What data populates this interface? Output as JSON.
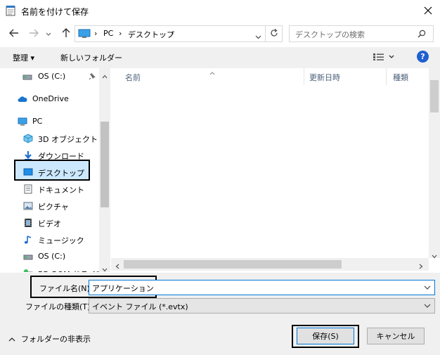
{
  "window": {
    "title": "名前を付けて保存",
    "close_icon": "close-icon"
  },
  "navigation": {
    "back_icon": "arrow-left-icon",
    "forward_icon": "arrow-right-icon",
    "recent_icon": "chevron-down-icon",
    "up_icon": "arrow-up-icon",
    "breadcrumbs": [
      "PC",
      "デスクトップ"
    ],
    "refresh_icon": "refresh-icon",
    "search_placeholder": "デスクトップの検索"
  },
  "toolbar": {
    "organize_label": "整理 ▾",
    "new_folder_label": "新しいフォルダー",
    "view_icon": "view-options-icon",
    "help_label": "?"
  },
  "nav_pane": {
    "items": [
      {
        "label": "OS (C:)",
        "icon": "drive-icon"
      },
      {
        "label": "OneDrive",
        "icon": "cloud-icon"
      },
      {
        "label": "PC",
        "icon": "computer-icon"
      },
      {
        "label": "3D オブジェクト",
        "icon": "cube-icon"
      },
      {
        "label": "ダウンロード",
        "icon": "download-icon"
      },
      {
        "label": "デスクトップ",
        "icon": "desktop-icon",
        "selected": true
      },
      {
        "label": "ドキュメント",
        "icon": "document-icon"
      },
      {
        "label": "ピクチャ",
        "icon": "picture-icon"
      },
      {
        "label": "ビデオ",
        "icon": "video-icon"
      },
      {
        "label": "ミュージック",
        "icon": "music-icon"
      },
      {
        "label": "OS (C:)",
        "icon": "drive-icon"
      },
      {
        "label": "BD-ROM ドライブ",
        "icon": "disc-icon"
      }
    ]
  },
  "file_list": {
    "columns": [
      "名前",
      "更新日時",
      "種類"
    ],
    "rows": []
  },
  "form": {
    "filename_label": "ファイル名(N):",
    "filename_value": "アプリケーション",
    "filetype_label": "ファイルの種類(T):",
    "filetype_value": "イベント ファイル (*.evtx)",
    "hide_folders_label": "フォルダーの非表示",
    "save_label": "保存(S)",
    "cancel_label": "キャンセル"
  }
}
